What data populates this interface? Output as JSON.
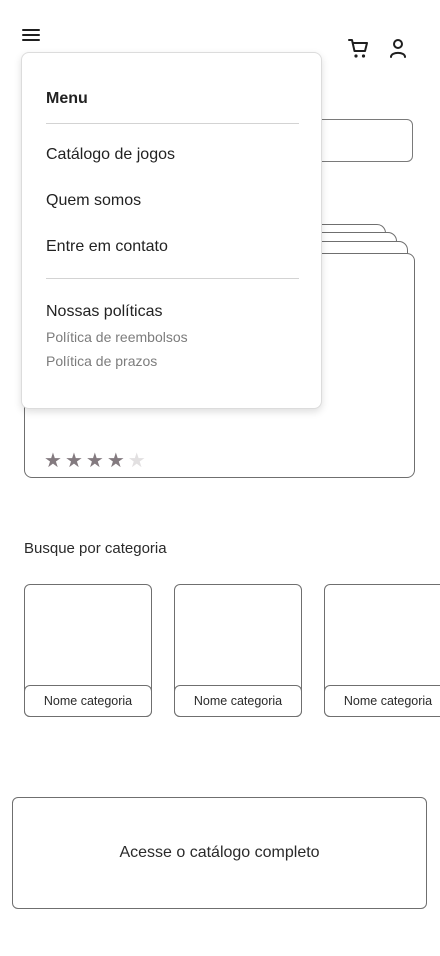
{
  "header": {
    "menu_icon": "hamburger-menu-icon",
    "cart_icon": "shopping-cart-icon",
    "user_icon": "user-profile-icon"
  },
  "menu": {
    "title": "Menu",
    "items": [
      {
        "label": "Catálogo de jogos"
      },
      {
        "label": "Quem somos"
      },
      {
        "label": "Entre em contato"
      }
    ],
    "policies": {
      "label": "Nossas políticas",
      "items": [
        {
          "label": "Política de reembolsos"
        },
        {
          "label": "Política de prazos"
        }
      ]
    }
  },
  "product": {
    "rating": 4,
    "rating_max": 5,
    "star_colors": {
      "filled": "#837a7f",
      "empty": "#e2e0e1"
    }
  },
  "categories": {
    "title": "Busque por categoria",
    "items": [
      {
        "label": "Nome categoria"
      },
      {
        "label": "Nome categoria"
      },
      {
        "label": "Nome categoria"
      }
    ]
  },
  "cta": {
    "label": "Acesse o catálogo completo"
  }
}
